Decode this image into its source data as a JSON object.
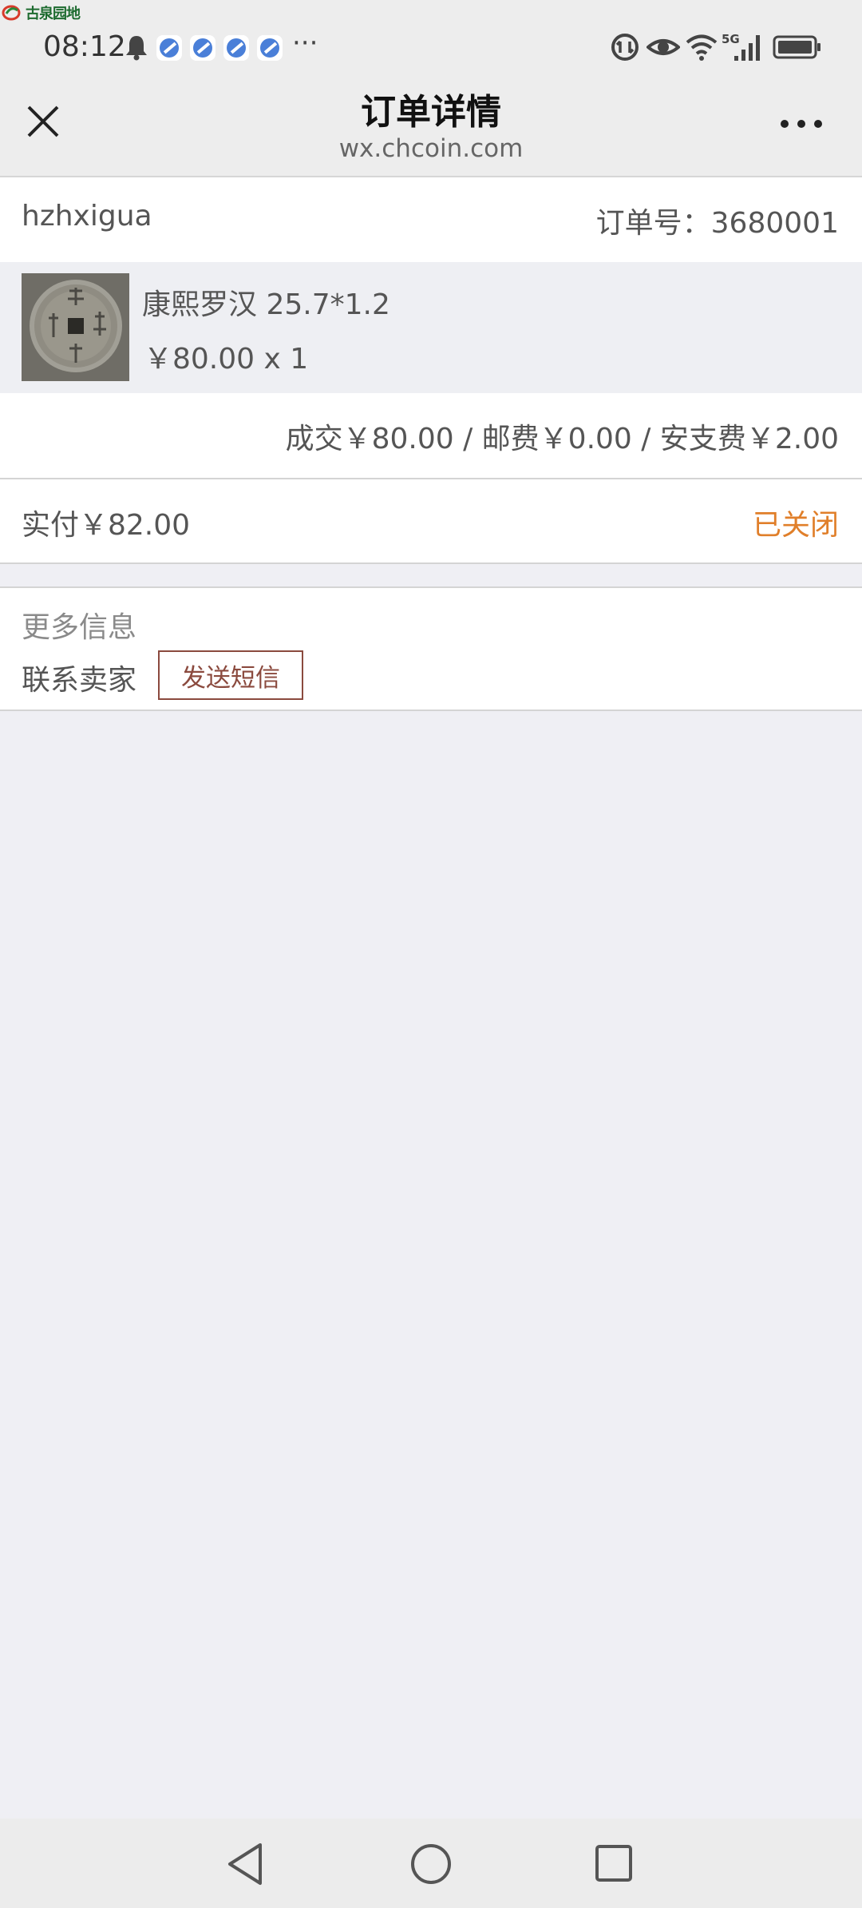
{
  "watermark": {
    "text": "古泉园地"
  },
  "status_bar": {
    "time": "08:12",
    "more": "···",
    "network": "5G",
    "icons": [
      "bell-icon",
      "app-notification-icon",
      "app-notification-icon",
      "app-notification-icon",
      "app-notification-icon",
      "data-saver-icon",
      "eye-icon",
      "wifi-icon",
      "signal-icon",
      "battery-icon"
    ]
  },
  "header": {
    "title": "订单详情",
    "subtitle": "wx.chcoin.com"
  },
  "order": {
    "buyer": "hzhxigua",
    "order_no": "订单号：3680001",
    "item": {
      "name": "康熙罗汉 25.7*1.2",
      "price_qty": "￥80.00 x 1"
    },
    "fees": "成交￥80.00 / 邮费￥0.00 / 安支费￥2.00",
    "paid": "实付￥82.00",
    "status": "已关闭"
  },
  "more_info": {
    "heading": "更多信息",
    "contact_label": "联系卖家",
    "sms_button": "发送短信"
  },
  "colors": {
    "status_orange": "#e07f2a",
    "button_border": "#8b4a3e",
    "page_bg": "#efeff4"
  }
}
